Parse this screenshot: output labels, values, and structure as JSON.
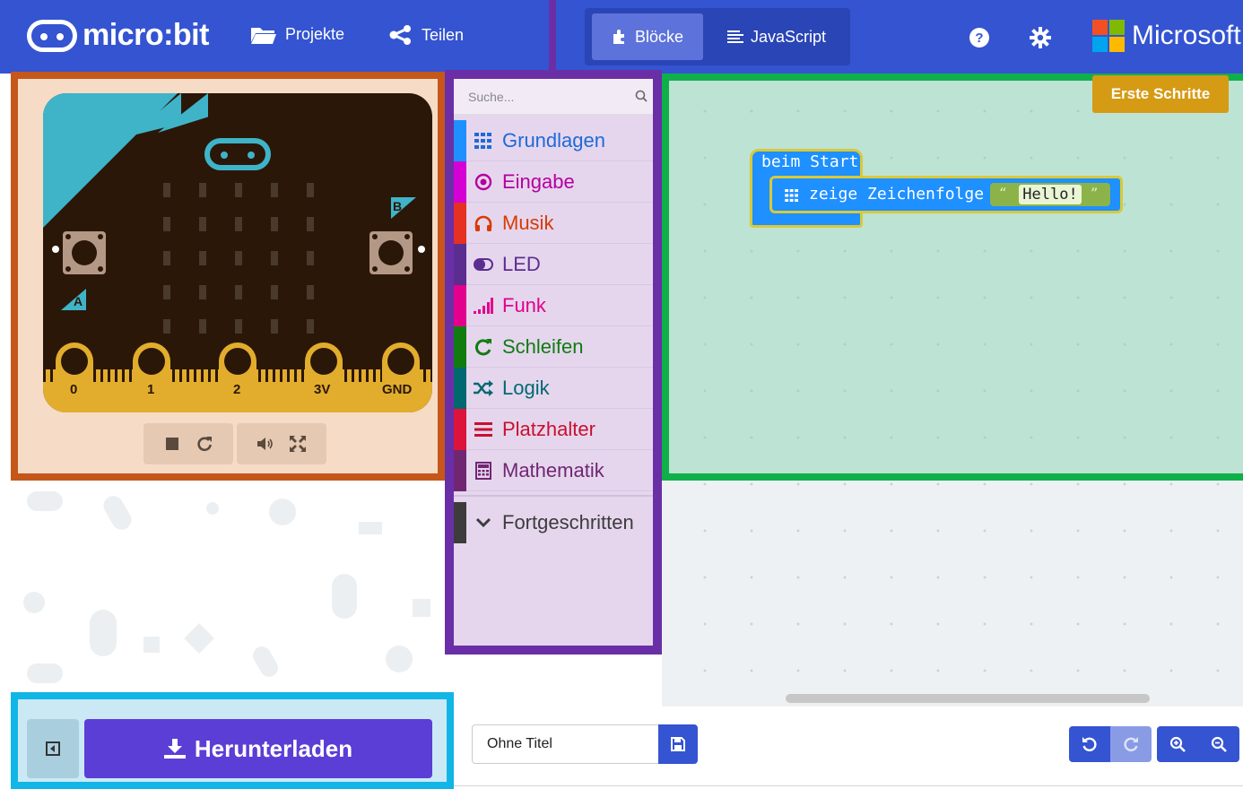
{
  "header": {
    "logo_text": "micro:bit",
    "nav": [
      {
        "label": "Projekte",
        "icon": "folder-icon"
      },
      {
        "label": "Teilen",
        "icon": "share-icon"
      }
    ],
    "mode_toggle": {
      "blocks_label": "Blöcke",
      "javascript_label": "JavaScript",
      "active": "Blöcke"
    },
    "help_icon": "help-icon",
    "settings_icon": "gear-icon",
    "brand_text": "Microsoft",
    "colors": {
      "bar": "#3454d1"
    }
  },
  "simulator": {
    "button_labels": {
      "a": "A",
      "b": "B"
    },
    "pins": [
      "0",
      "1",
      "2",
      "3V",
      "GND"
    ],
    "controls": [
      "stop-icon",
      "restart-icon",
      "sound-icon",
      "fullscreen-icon"
    ]
  },
  "toolbox": {
    "search_placeholder": "Suche...",
    "categories": [
      {
        "label": "Grundlagen",
        "color": "#1e90ff",
        "icon": "grid-icon"
      },
      {
        "label": "Eingabe",
        "color": "#d400d4",
        "icon": "target-icon"
      },
      {
        "label": "Musik",
        "color": "#e63022",
        "icon": "headphones-icon"
      },
      {
        "label": "LED",
        "color": "#5c2d91",
        "icon": "toggle-icon"
      },
      {
        "label": "Funk",
        "color": "#e3008c",
        "icon": "signal-icon"
      },
      {
        "label": "Schleifen",
        "color": "#107c10",
        "icon": "loop-icon"
      },
      {
        "label": "Logik",
        "color": "#006970",
        "icon": "shuffle-icon"
      },
      {
        "label": "Platzhalter",
        "color": "#dc143c",
        "icon": "lines-icon"
      },
      {
        "label": "Mathematik",
        "color": "#712672",
        "icon": "calculator-icon"
      },
      {
        "label": "Fortgeschritten",
        "color": "#3c3c3c",
        "icon": "chevron-down-icon"
      }
    ]
  },
  "workspace": {
    "tutorial_button": "Erste Schritte",
    "blocks": {
      "start_label": "beim Start",
      "show_label": "zeige Zeichenfolge",
      "open_quote": "“",
      "close_quote": "”",
      "string_value": "Hello!"
    }
  },
  "footer": {
    "download_label": "Herunterladen",
    "project_title": "Ohne Titel",
    "save_icon": "save-icon",
    "undo_icon": "undo-icon",
    "redo_icon": "redo-icon",
    "zoom_in_icon": "zoom-in-icon",
    "zoom_out_icon": "zoom-out-icon"
  }
}
